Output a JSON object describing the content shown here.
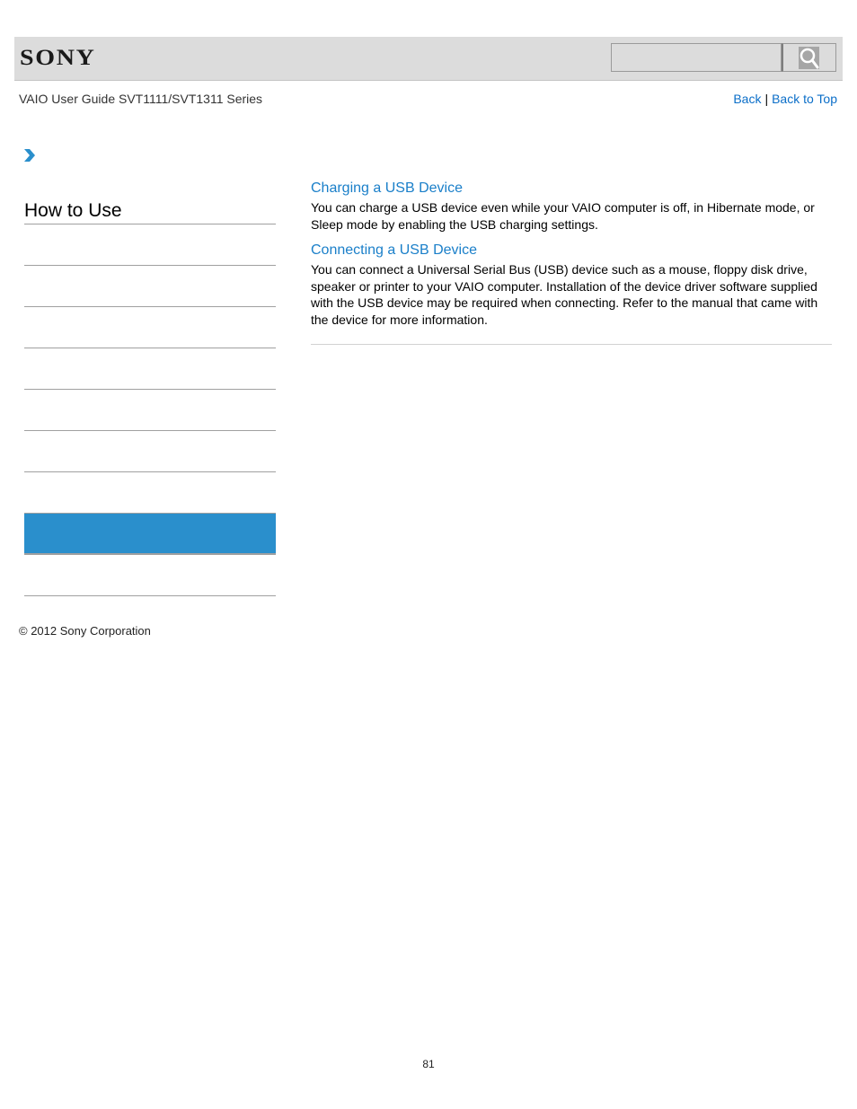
{
  "header": {
    "logo": "SONY",
    "search_placeholder": "",
    "search_icon": "magnifier-icon"
  },
  "nav": {
    "guide_title": "VAIO User Guide SVT1111/SVT1311 Series",
    "back_label": "Back",
    "separator": "|",
    "back_to_top_label": "Back to Top"
  },
  "breadcrumb": {
    "icon": "chevron-right-icon"
  },
  "sidebar": {
    "title": "How to Use",
    "items": [
      {
        "label": "",
        "active": false
      },
      {
        "label": "",
        "active": false
      },
      {
        "label": "",
        "active": false
      },
      {
        "label": "",
        "active": false
      },
      {
        "label": "",
        "active": false
      },
      {
        "label": "",
        "active": false
      },
      {
        "label": "",
        "active": false
      },
      {
        "label": "",
        "active": true
      },
      {
        "label": "",
        "active": false
      }
    ]
  },
  "main": {
    "sections": [
      {
        "title": "Charging a USB Device",
        "body": "You can charge a USB device even while your VAIO computer is off, in Hibernate mode, or Sleep mode by enabling the USB charging settings."
      },
      {
        "title": "Connecting a USB Device",
        "body": "You can connect a Universal Serial Bus (USB) device such as a mouse, floppy disk drive, speaker or printer to your VAIO computer. Installation of the device driver software supplied with the USB device may be required when connecting. Refer to the manual that came with the device for more information."
      }
    ]
  },
  "footer": {
    "copyright": "© 2012 Sony Corporation",
    "page_number": "81"
  },
  "colors": {
    "link": "#1a7fc9",
    "active_item": "#2a8fcc",
    "header_bg": "#dcdcdc"
  }
}
